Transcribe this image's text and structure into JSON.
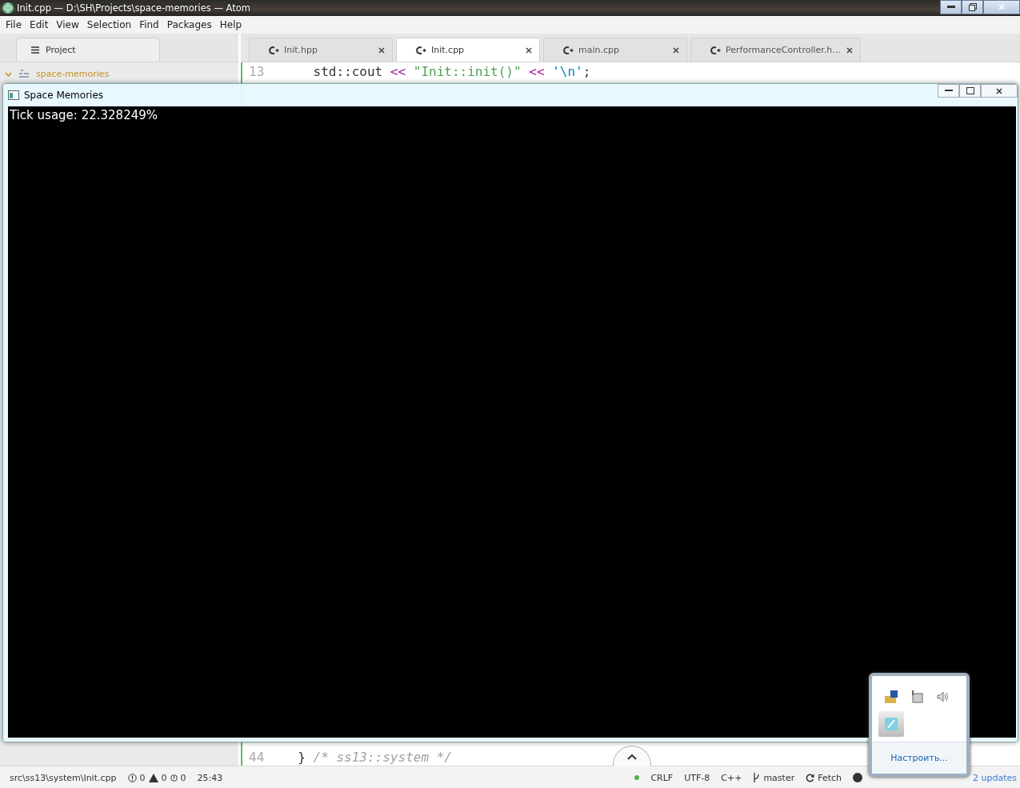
{
  "window": {
    "title": "Init.cpp — D:\\SH\\Projects\\space-memories — Atom"
  },
  "menu": [
    "File",
    "Edit",
    "View",
    "Selection",
    "Find",
    "Packages",
    "Help"
  ],
  "sidebar": {
    "tab": {
      "label": "Project"
    },
    "tree": [
      {
        "label": "space-memories",
        "expanded": true
      }
    ]
  },
  "tabs": [
    {
      "label": "Init.hpp",
      "selected": false
    },
    {
      "label": "Init.cpp",
      "selected": true
    },
    {
      "label": "main.cpp",
      "selected": false
    },
    {
      "label": "PerformanceController.h...",
      "selected": false
    }
  ],
  "editor": {
    "lines": [
      {
        "number": "13",
        "tokens": [
          {
            "kind": "plain",
            "text": "    std::cout"
          },
          {
            "kind": "op",
            "text": " << "
          },
          {
            "kind": "string",
            "text": "\"Init::init()\""
          },
          {
            "kind": "op",
            "text": " << "
          },
          {
            "kind": "char",
            "text": "'\\n'"
          },
          {
            "kind": "plain",
            "text": ";"
          }
        ]
      },
      {
        "number": "44",
        "tokens": [
          {
            "kind": "plain",
            "text": "  } "
          },
          {
            "kind": "comment",
            "text": "/* ss13::system */"
          }
        ]
      }
    ]
  },
  "app_window": {
    "title": "Space Memories",
    "output": "Tick usage: 22.328249%"
  },
  "status_bar": {
    "path": "src\\ss13\\system\\Init.cpp",
    "errors": "0",
    "warnings": "0",
    "infos": "0",
    "cursor": "25:43",
    "line_ending": "CRLF",
    "encoding": "UTF-8",
    "grammar": "C++",
    "branch": "master",
    "fetch": "Fetch",
    "updates": "2 updates"
  },
  "tray_popup": {
    "link": "Настроить..."
  }
}
